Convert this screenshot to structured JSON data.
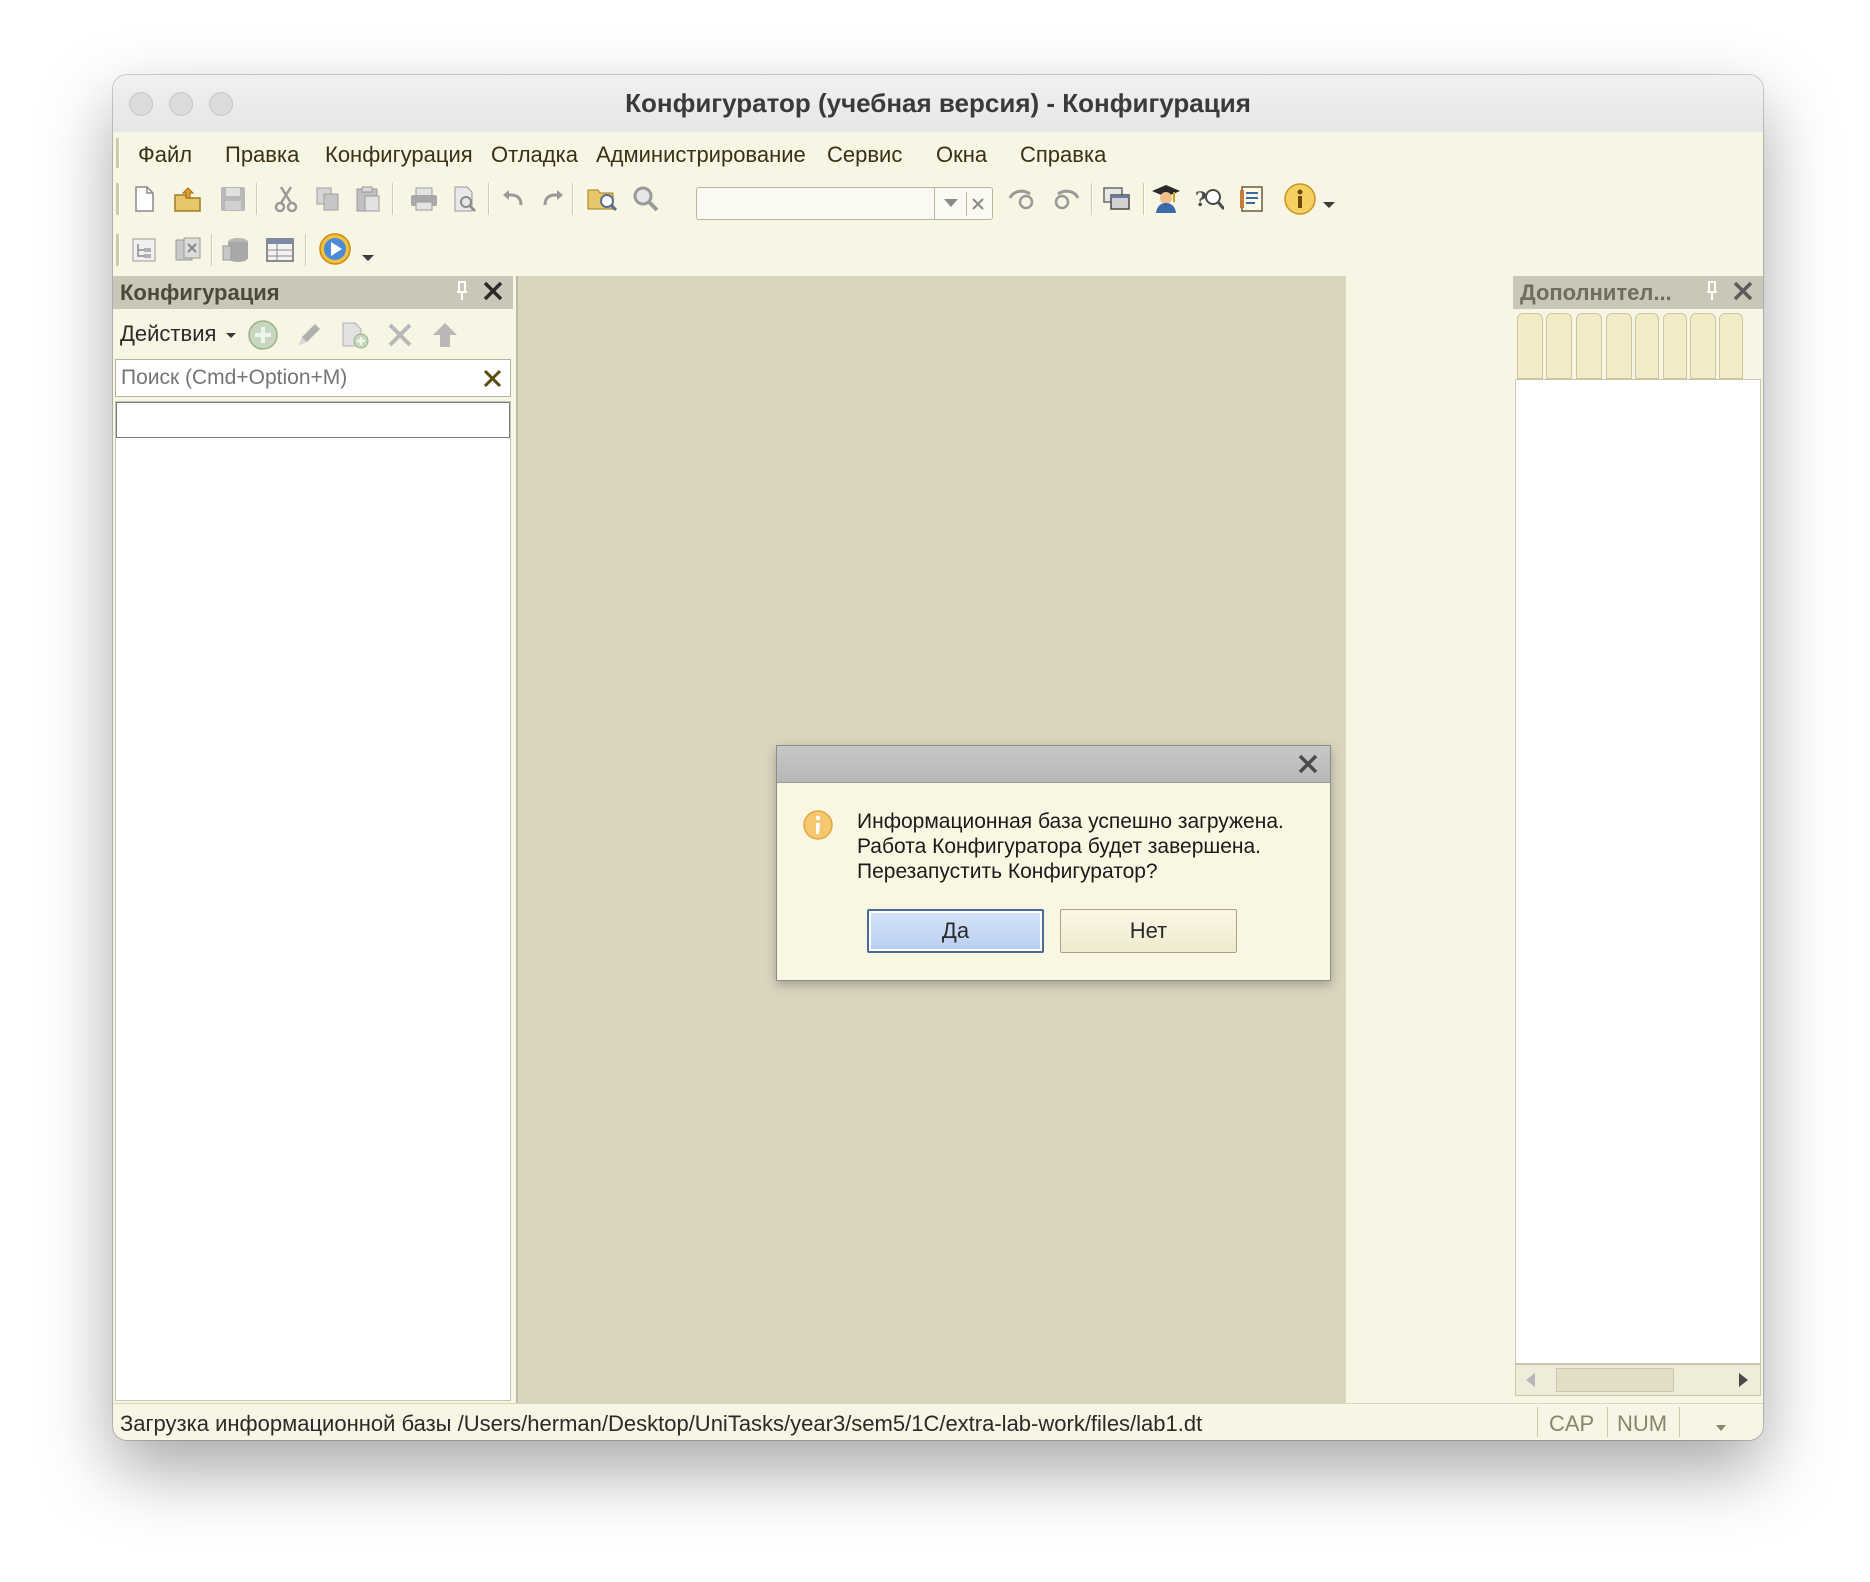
{
  "window": {
    "title": "Конфигуратор (учебная версия) - Конфигурация"
  },
  "menu": {
    "items": [
      "Файл",
      "Правка",
      "Конфигурация",
      "Отладка",
      "Администрирование",
      "Сервис",
      "Окна",
      "Справка"
    ]
  },
  "toolbar": {
    "search": {
      "value": ""
    },
    "icons_row1": [
      "new-icon",
      "open-icon",
      "save-icon",
      "cut-icon",
      "copy-icon",
      "paste-icon",
      "print-icon",
      "print-preview-icon",
      "undo-icon",
      "redo-icon",
      "find-in-files-icon",
      "search-icon",
      "search-back-icon",
      "search-forward-icon",
      "windows-icon",
      "assistant-icon",
      "syntax-helper-icon",
      "help-icon",
      "info-icon"
    ],
    "icons_row2": [
      "config-tree-icon",
      "compare-icon",
      "database-icon",
      "table-icon",
      "run-debug-icon"
    ]
  },
  "left_panel": {
    "title": "Конфигурация",
    "actions_label": "Действия",
    "search_placeholder": "Поиск (Cmd+Option+M)"
  },
  "right_panel": {
    "title": "Дополнител..."
  },
  "dialog": {
    "line1": "Информационная база успешно загружена.",
    "line2": "Работа Конфигуратора будет завершена.",
    "line3": "Перезапустить Конфигуратор?",
    "yes_label": "Да",
    "no_label": "Нет"
  },
  "statusbar": {
    "message": "Загрузка информационной базы /Users/herman/Desktop/UniTasks/year3/sem5/1C/extra-lab-work/files/lab1.dt",
    "cap": "CAP",
    "num": "NUM"
  }
}
